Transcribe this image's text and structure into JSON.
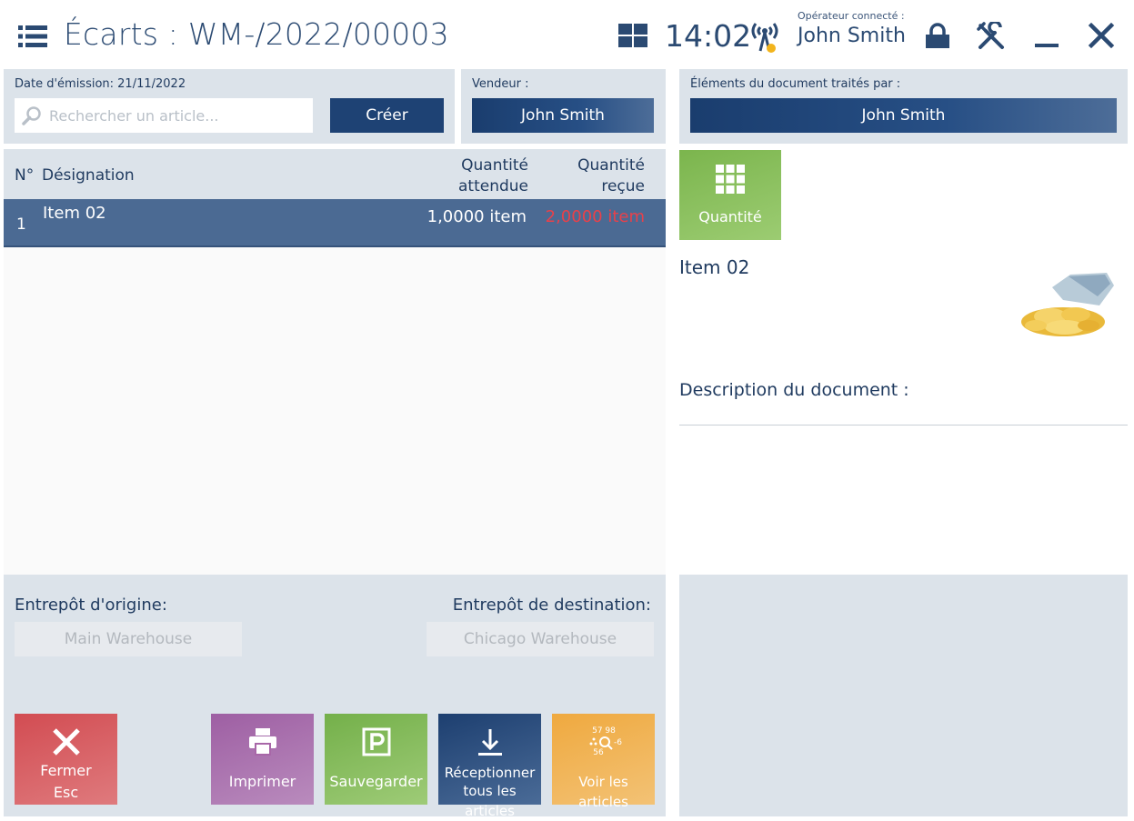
{
  "header": {
    "title": "Écarts : WM-/2022/00003",
    "time": "14:02",
    "operator_label": "Opérateur connecté :",
    "operator_name": "John Smith"
  },
  "doc_panel": {
    "issue_date_label": "Date d'émission: 21/11/2022",
    "search_placeholder": "Rechercher un article...",
    "create_label": "Créer"
  },
  "vendor_panel": {
    "label": "Vendeur :",
    "name": "John Smith"
  },
  "processed_panel": {
    "label": "Éléments du document traités par :",
    "name": "John Smith"
  },
  "table": {
    "col_no": "N°",
    "col_designation": "Désignation",
    "col_expected_line1": "Quantité",
    "col_expected_line2": "attendue",
    "col_received_line1": "Quantité",
    "col_received_line2": "reçue",
    "rows": [
      {
        "no": "1",
        "designation": "Item 02",
        "expected": "1,0000 item",
        "received": "2,0000 item"
      }
    ]
  },
  "details": {
    "quantity_tile_label": "Quantité",
    "item_name": "Item 02",
    "description_label": "Description du document :"
  },
  "warehouses": {
    "origin_label": "Entrepôt d'origine:",
    "origin_value": "Main Warehouse",
    "destination_label": "Entrepôt de destination:",
    "destination_value": "Chicago Warehouse"
  },
  "actions": {
    "close_line1": "Fermer",
    "close_line2": "Esc",
    "print": "Imprimer",
    "save": "Sauvegarder",
    "receive_line1": "Réceptionner",
    "receive_line2": "tous les articles",
    "view_items": "Voir les articles",
    "view_icon_text_top": "57 98",
    "view_icon_text_bottom": "56"
  },
  "colors": {
    "panel_bg": "#dce3ea",
    "primary_blue": "#1a3d6e",
    "selected_row": "#4b6a93",
    "discrepancy_red": "#e8414a",
    "tile_red": "#d9535a",
    "tile_purple": "#a867a8",
    "tile_green": "#7bb54d",
    "tile_navy": "#1e4274",
    "tile_orange": "#f0ac48"
  }
}
